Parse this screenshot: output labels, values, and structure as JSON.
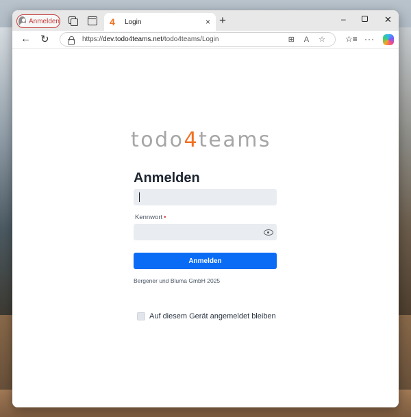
{
  "browser": {
    "profile_label": "Anmelden",
    "tab": {
      "favicon_text": "4",
      "title": "Login",
      "close_glyph": "×"
    },
    "new_tab_glyph": "+",
    "window_controls": {
      "minimize": "–",
      "close": "✕"
    },
    "nav": {
      "back": "←",
      "reload": "↻"
    },
    "url": {
      "prefix": "https://",
      "host": "dev.todo4teams.net",
      "path": "/todo4teams/Login"
    },
    "toolbar": {
      "more": "···"
    }
  },
  "page": {
    "logo": {
      "part1": "todo",
      "part2": "4",
      "part3": "teams"
    },
    "heading": "Anmelden",
    "username_value": "",
    "password_label": "Kennwort",
    "required_marker": "•",
    "password_value": "",
    "submit_label": "Anmelden",
    "copyright": "Bergener und Bluma GmbH 2025",
    "remember_label": "Auf diesem Gerät angemeldet bleiben",
    "remember_checked": false
  },
  "colors": {
    "accent_blue": "#0a6cf5",
    "logo_orange": "#f26f21",
    "logo_gray": "#a6a6a6",
    "profile_red": "#c23a3a"
  }
}
